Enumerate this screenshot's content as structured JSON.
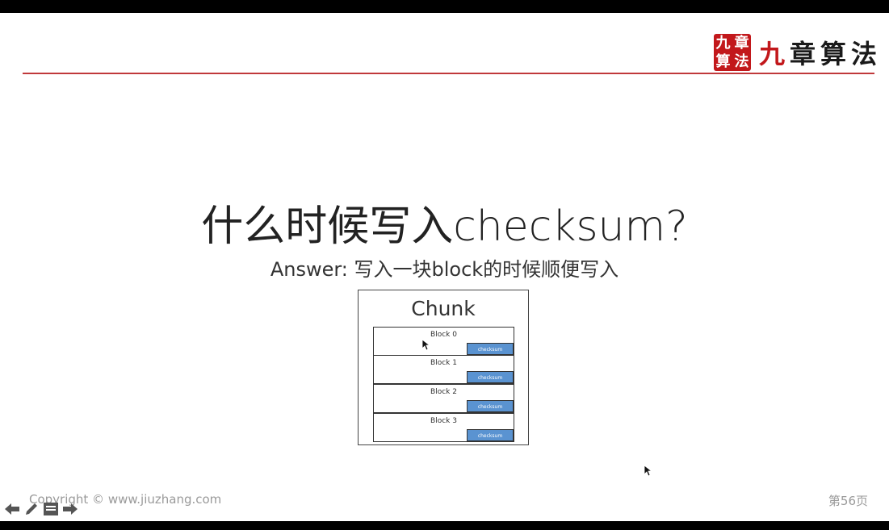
{
  "header": {
    "logo_seal_chars": [
      "九",
      "章",
      "算",
      "法"
    ],
    "brand_first": "九",
    "brand_rest": "章算法"
  },
  "slide": {
    "title": "什么时候写入checksum?",
    "subtitle": "Answer: 写入一块block的时候顺便写入",
    "diagram": {
      "title": "Chunk",
      "blocks": [
        {
          "label": "Block 0",
          "tag": "checksum"
        },
        {
          "label": "Block 1",
          "tag": "checksum"
        },
        {
          "label": "Block 2",
          "tag": "checksum"
        },
        {
          "label": "Block 3",
          "tag": "checksum"
        }
      ]
    }
  },
  "footer": {
    "copyright": "Copyright © www.jiuzhang.com",
    "page": "第56页"
  },
  "nav": {
    "icons": [
      "arrow-left-icon",
      "pencil-icon",
      "notes-icon",
      "arrow-right-icon"
    ]
  },
  "colors": {
    "accent_red": "#c2181b",
    "rule": "#c0393b",
    "checksum_blue": "#5a93d1"
  }
}
